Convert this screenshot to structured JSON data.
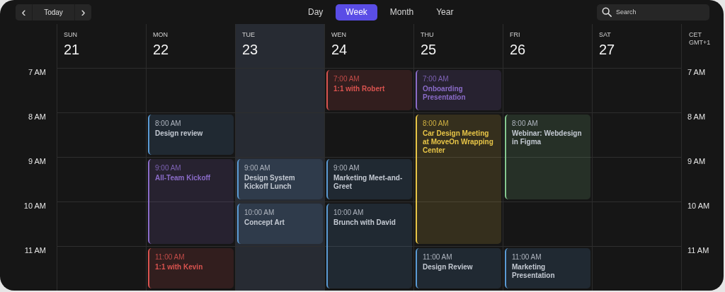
{
  "toolbar": {
    "previous": "‹",
    "today": "Today",
    "next": "›"
  },
  "views": [
    {
      "label": "Day",
      "selected": false
    },
    {
      "label": "Week",
      "selected": true
    },
    {
      "label": "Month",
      "selected": false
    },
    {
      "label": "Year",
      "selected": false
    }
  ],
  "search": {
    "placeholder": "Search"
  },
  "timezone": {
    "name": "CET",
    "offset": "GMT+1"
  },
  "hours_left": [
    "7 AM",
    "8 AM",
    "9 AM",
    "10 AM",
    "11 AM"
  ],
  "hours_right": [
    "7 AM",
    "8 AM",
    "9 AM",
    "10 AM",
    "11 AM"
  ],
  "days": [
    {
      "name": "SUN",
      "date": "21",
      "selected": false
    },
    {
      "name": "MON",
      "date": "22",
      "selected": false,
      "slots": [
        {
          "kind": "free"
        },
        {
          "kind": "event",
          "time": "8:00 AM",
          "title": "Design review",
          "color": "#5b9bd5",
          "highlight": false
        },
        {
          "kind": "event",
          "time": "9:00 AM",
          "title": "All-Team Kickoff",
          "color": "#8b6cc9",
          "highlight": true
        },
        {
          "kind": "continued"
        },
        {
          "kind": "event",
          "time": "11:00 AM",
          "title": "1:1 with Kevin",
          "color": "#d9534f",
          "highlight": true
        }
      ]
    },
    {
      "name": "TUE",
      "date": "23",
      "selected": true,
      "slots": [
        {
          "kind": "free"
        },
        {
          "kind": "free"
        },
        {
          "kind": "event",
          "time": "9:00 AM",
          "title": "Design System Kickoff Lunch",
          "color": "#5b9bd5",
          "highlight": false
        },
        {
          "kind": "event",
          "time": "10:00 AM",
          "title": "Concept Art",
          "color": "#5b9bd5",
          "highlight": false
        }
      ]
    },
    {
      "name": "WEN",
      "date": "24",
      "selected": false,
      "slots": [
        {
          "kind": "event",
          "time": "7:00 AM",
          "title": "1:1 with Robert",
          "color": "#d9534f",
          "highlight": true
        },
        {
          "kind": "free"
        },
        {
          "kind": "event",
          "time": "9:00 AM",
          "title": "Marketing Meet-and-Greet",
          "color": "#5b9bd5",
          "highlight": false
        },
        {
          "kind": "event",
          "time": "10:00 AM",
          "title": "Brunch with David",
          "color": "#5b9bd5",
          "highlight": false
        },
        {
          "kind": "continued"
        }
      ]
    },
    {
      "name": "THU",
      "date": "25",
      "selected": false,
      "slots": [
        {
          "kind": "event",
          "time": "7:00 AM",
          "title": "Onboarding Presentation",
          "color": "#8b6cc9",
          "highlight": true
        },
        {
          "kind": "event",
          "time": "8:00 AM",
          "title": "Car Design Meeting at MoveOn Wrapping Center",
          "color": "#e8c547",
          "highlight": true
        },
        {
          "kind": "continued"
        },
        {
          "kind": "continued"
        },
        {
          "kind": "event",
          "time": "11:00 AM",
          "title": "Design Review",
          "color": "#5b9bd5",
          "highlight": false
        }
      ]
    },
    {
      "name": "FRI",
      "date": "26",
      "selected": false,
      "slots": [
        {
          "kind": "free"
        },
        {
          "kind": "event",
          "time": "8:00 AM",
          "title": "Webinar: Webdesign in Figma",
          "color": "#86c98f",
          "highlight": false
        },
        {
          "kind": "continued"
        },
        {
          "kind": "free"
        },
        {
          "kind": "event",
          "time": "11:00 AM",
          "title": "Marketing Presentation",
          "color": "#5b9bd5",
          "highlight": false
        }
      ]
    },
    {
      "name": "SAT",
      "date": "27",
      "selected": false
    }
  ]
}
